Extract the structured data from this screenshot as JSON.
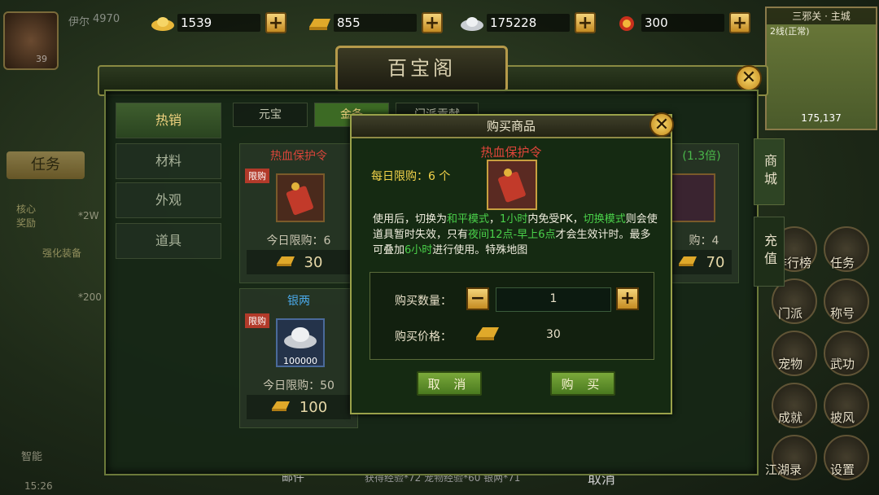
{
  "player": {
    "name": "伊尔",
    "power": "4970",
    "level": "39"
  },
  "currencies": [
    {
      "icon": "gold-ingot-icon",
      "value": "1539"
    },
    {
      "icon": "gold-bar-icon",
      "value": "855"
    },
    {
      "icon": "silver-ingot-icon",
      "value": "175228"
    },
    {
      "icon": "red-pouch-icon",
      "value": "300"
    }
  ],
  "minimap": {
    "title": "三邪关 · 主城",
    "line": "2线(正常)",
    "coords": "175,137"
  },
  "shop": {
    "title": "百宝阁",
    "left_tabs": [
      "热销",
      "材料",
      "外观",
      "道具"
    ],
    "top_tabs": [
      "元宝",
      "金条",
      "门派贡献"
    ],
    "side_tabs": [
      "商城",
      "充值"
    ],
    "cards": [
      {
        "name": "热血保护令",
        "tag": "限购",
        "daily": "今日限购：6",
        "price": "30",
        "currency_icon": "gold-bar-icon"
      },
      {
        "name": "银两",
        "tag": "限购",
        "amount": "100000",
        "daily": "今日限购：50",
        "price": "100",
        "currency_icon": "gold-bar-icon"
      },
      {
        "name": "(1.3倍)",
        "daily": "购：4",
        "price": "70",
        "currency_icon": "gold-bar-icon"
      }
    ]
  },
  "dialog": {
    "title": "购买商品",
    "item_name": "热血保护令",
    "daily_limit": "每日限购：6 个",
    "desc_1": "使用后，切换为",
    "desc_peace": "和平模式",
    "desc_2": "，",
    "desc_hour": "1小时",
    "desc_3": "内免受PK，",
    "desc_switch": "切换模式",
    "desc_4": "则会使道具暂时失效，只有",
    "desc_night": "夜间12点-早上6点",
    "desc_5": "才会生效计时。最多可叠加",
    "desc_six": "6小时",
    "desc_6": "进行使用。特殊地图",
    "qty_label": "购买数量：",
    "qty_value": "1",
    "price_label": "购买价格：",
    "price_value": "30",
    "cancel": "取 消",
    "buy": "购 买"
  },
  "left_hud": {
    "task": "任务",
    "smart": "智能",
    "time": "15:26",
    "core_reward": "核心奖励",
    "reward_1": "*2W",
    "reward_2": "*200",
    "quest": "强化装备"
  },
  "right_menu": [
    "排行榜",
    "任务",
    "门派",
    "称号",
    "宠物",
    "武功",
    "成就",
    "披风",
    "江湖录",
    "设置"
  ],
  "bottom_bar": {
    "mail": "邮件",
    "chat": "获得经验*72 宠物经验*60 银两*71",
    "cancel": "取消"
  }
}
